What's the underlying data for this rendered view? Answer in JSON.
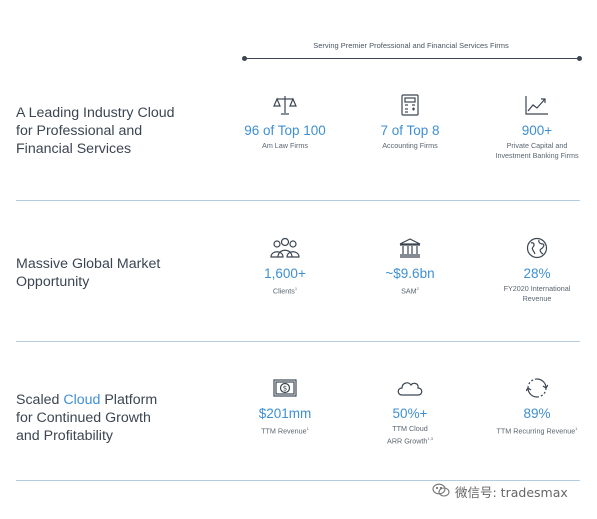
{
  "header": {
    "caption": "Serving Premier Professional and Financial Services Firms"
  },
  "rows": [
    {
      "title_lines": [
        "A Leading Industry Cloud",
        "for Professional and",
        "Financial Services"
      ],
      "stats": [
        {
          "icon": "scales-icon",
          "value": "96 of Top 100",
          "label_lines": [
            "Am Law Firms"
          ]
        },
        {
          "icon": "calculator-icon",
          "value": "7 of Top 8",
          "label_lines": [
            "Accounting Firms"
          ]
        },
        {
          "icon": "growth-chart-icon",
          "value": "900+",
          "label_lines": [
            "Private Capital and",
            "Investment Banking Firms"
          ]
        }
      ]
    },
    {
      "title_lines": [
        "Massive Global Market",
        "Opportunity"
      ],
      "stats": [
        {
          "icon": "people-icon",
          "value": "1,600+",
          "label_lines": [
            "Clients",
            "1"
          ]
        },
        {
          "icon": "bank-icon",
          "value": "~$9.6bn",
          "label_lines": [
            "SAM",
            "2"
          ]
        },
        {
          "icon": "globe-icon",
          "value": "28%",
          "label_lines": [
            "FY2020 International",
            "Revenue"
          ]
        }
      ]
    },
    {
      "title_parts": [
        "Scaled ",
        "Cloud",
        " Platform"
      ],
      "title_lines": [
        "for Continued Growth",
        "and Profitability"
      ],
      "stats": [
        {
          "icon": "dollar-bill-icon",
          "value": "$201mm",
          "label_lines": [
            "TTM Revenue",
            "1"
          ]
        },
        {
          "icon": "cloud-icon",
          "value": "50%+",
          "label_lines": [
            "TTM Cloud",
            "ARR Growth",
            "1,3"
          ]
        },
        {
          "icon": "recurring-icon",
          "value": "89%",
          "label_lines": [
            "TTM Recurring Revenue",
            "1"
          ]
        }
      ]
    }
  ],
  "watermark": {
    "text": "微信号: tradesmax"
  }
}
